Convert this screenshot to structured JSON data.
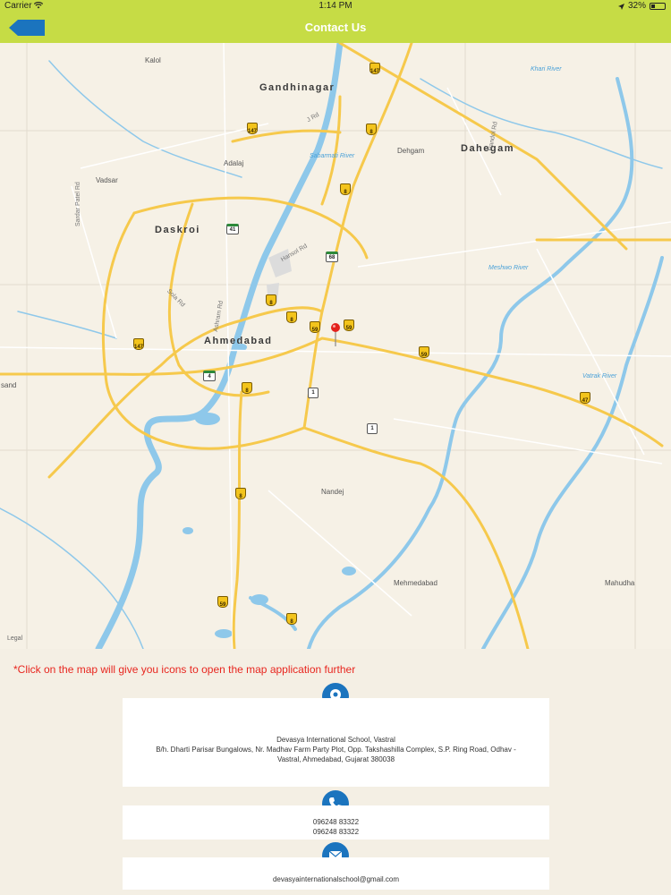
{
  "status_bar": {
    "carrier": "Carrier",
    "time": "1:14 PM",
    "battery_text": "32%",
    "battery_level": 0.32
  },
  "nav": {
    "title": "Contact Us",
    "back_icon": "back-arrow-icon"
  },
  "map": {
    "place_labels": {
      "gandhinagar": "Gandhinagar",
      "dahegam_region": "Dahegam",
      "daskroi": "Daskroi",
      "ahmedabad": "Ahmedabad",
      "kalol": "Kalol",
      "adalaj": "Adalaj",
      "vadsar": "Vadsar",
      "dehgam": "Dehgam",
      "nandej": "Nandej",
      "mehmedabad": "Mehmedabad",
      "mahudha": "Mahudha",
      "sand": "sand"
    },
    "river_labels": {
      "sabarmati": "Sabarmati River",
      "meshwo": "Meshwo River",
      "vatrak": "Vatrak River",
      "khari": "Khari River"
    },
    "road_labels": {
      "j_rd": "J Rd",
      "hansol": "Hansol Rd",
      "sola": "Sola Rd",
      "ashram": "Ashram Rd",
      "sardar_patel": "Sardar Patel Rd",
      "nandol": "Nandol Rd"
    },
    "legal": "Legal",
    "pin_icon": "map-pin-icon",
    "accent_road": "#f6c94c",
    "water": "#8ec8ea"
  },
  "note": "*Click on the map will give you icons to open the map application further",
  "contact": {
    "accent": "#1b74be",
    "address_icon": "location-pin-icon",
    "address_name": "Devasya International School, Vastral",
    "address_line1": "B/h. Dharti Parisar Bungalows, Nr. Madhav Farm Party Plot, Opp. Takshashilla Complex, S.P. Ring Road, Odhav -",
    "address_line2": "Vastral, Ahmedabad, Gujarat 380038",
    "phone_icon": "phone-icon",
    "phone_1": "096248 83322",
    "phone_2": "096248 83322",
    "email_icon": "envelope-icon",
    "email": "devasyainternationalschool@gmail.com"
  }
}
